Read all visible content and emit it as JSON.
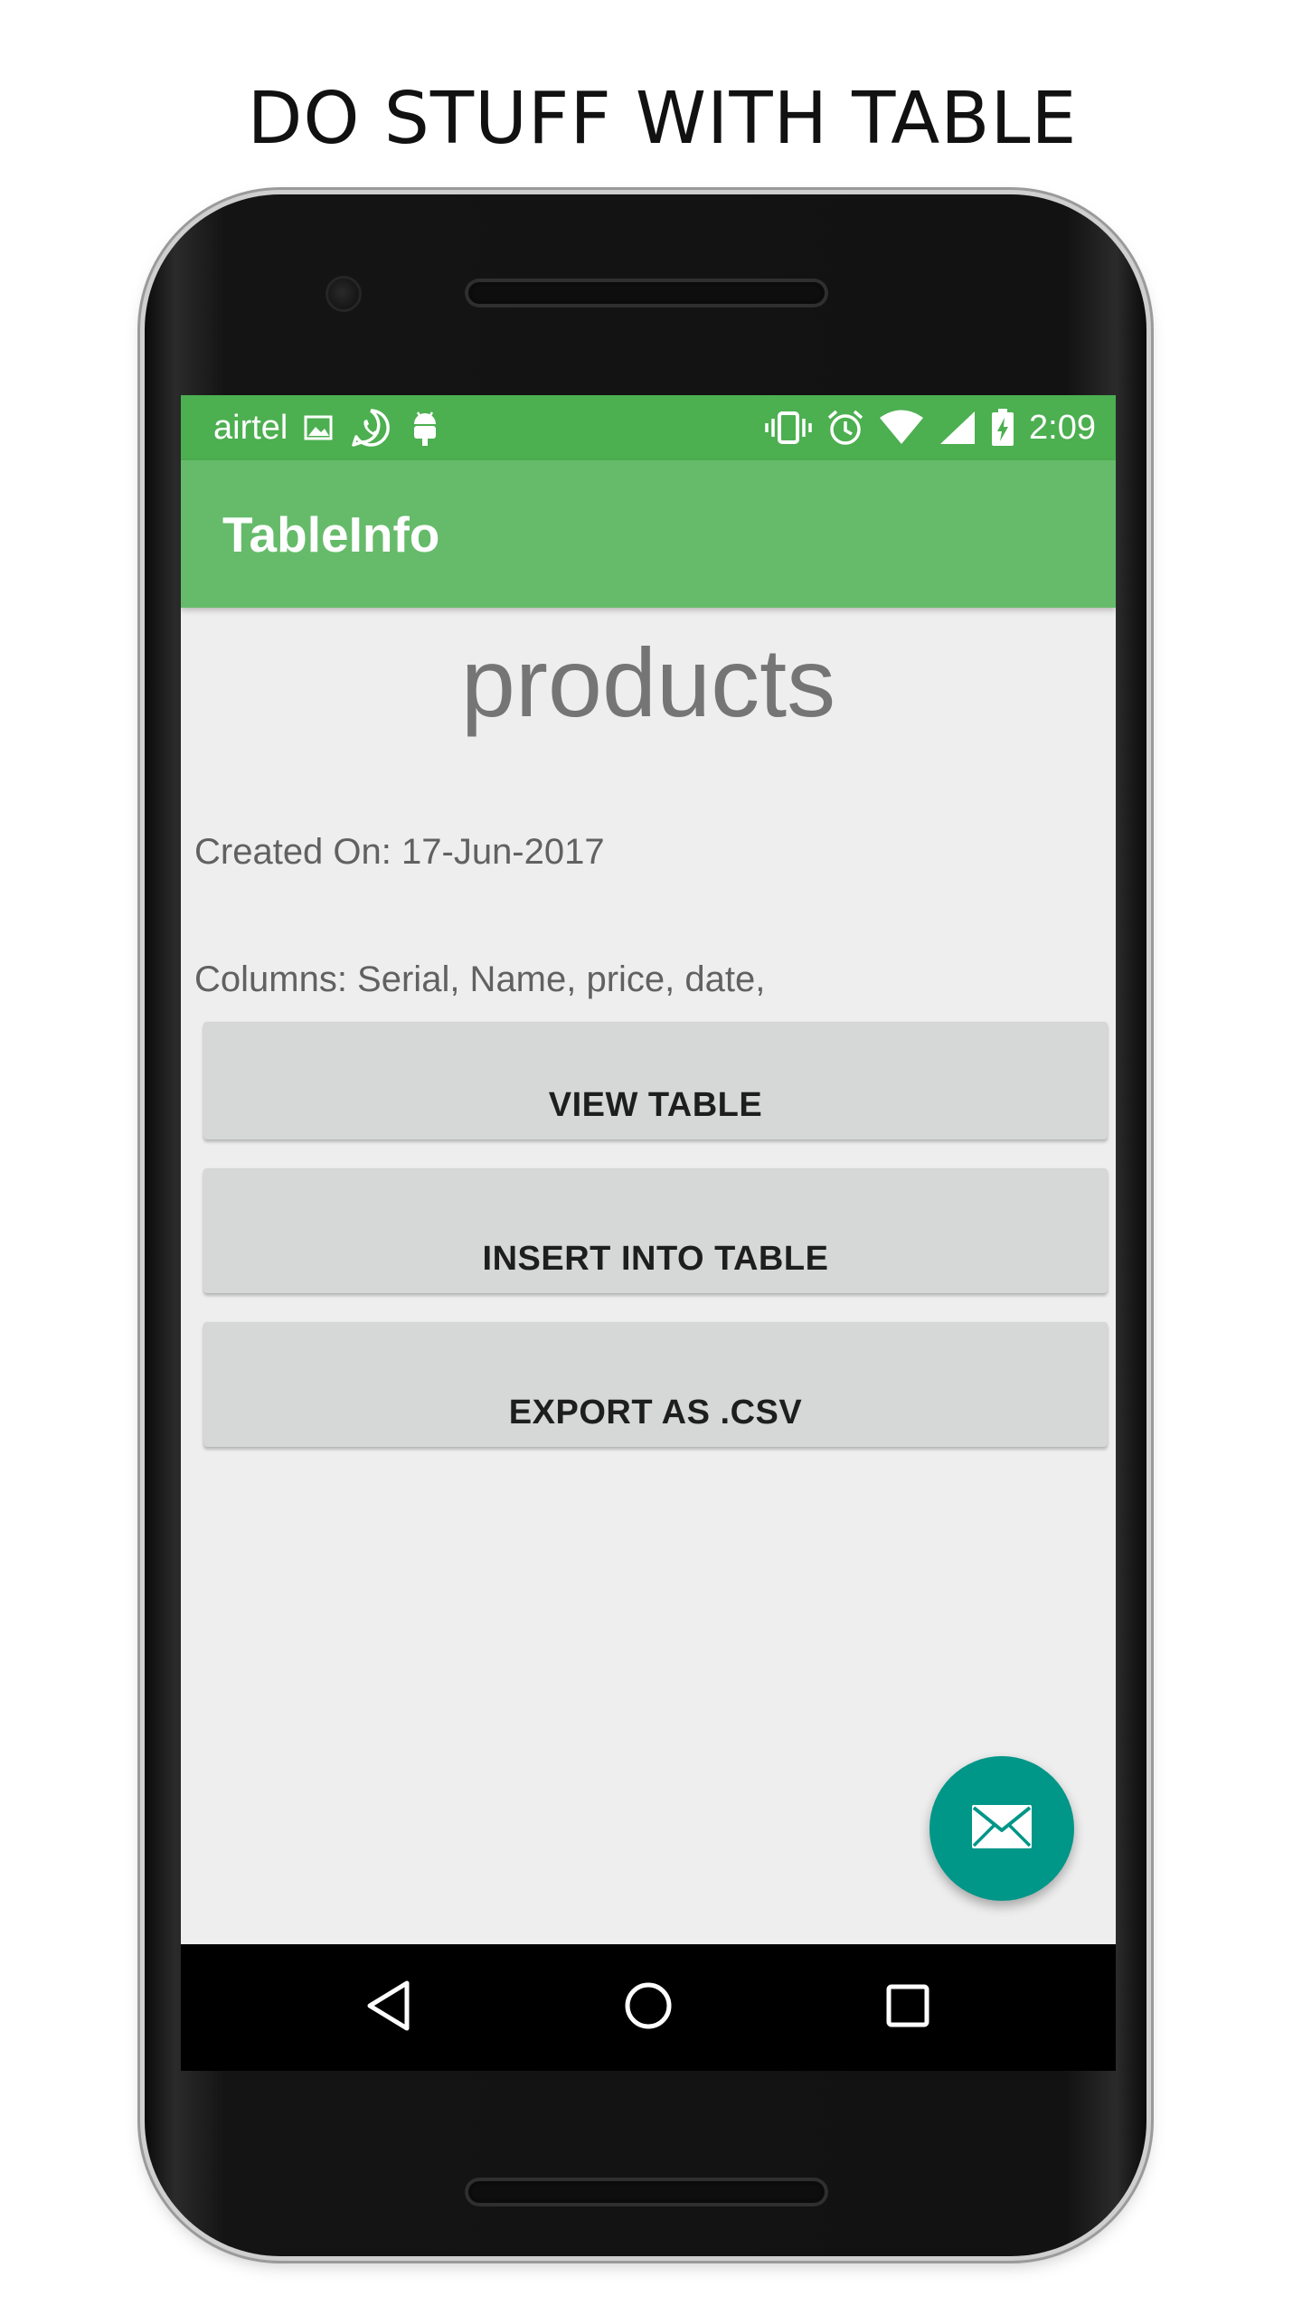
{
  "headline": "DO STUFF WITH TABLE",
  "status_bar": {
    "carrier": "airtel",
    "time": "2:09",
    "left_icons": [
      "image-icon",
      "whatsapp-icon",
      "android-icon"
    ],
    "right_icons": [
      "vibrate-icon",
      "alarm-icon",
      "wifi-icon",
      "signal-icon",
      "battery-charging-icon"
    ]
  },
  "app_bar": {
    "title": "TableInfo"
  },
  "table": {
    "name": "products",
    "created_on": "Created On: 17-Jun-2017",
    "columns": "Columns: Serial, Name, price, date,"
  },
  "buttons": {
    "view": "VIEW TABLE",
    "insert": "INSERT INTO TABLE",
    "export": "EXPORT AS .CSV"
  },
  "fab": {
    "icon": "mail-icon"
  },
  "nav_bar": {
    "icons": [
      "back-icon",
      "home-icon",
      "recents-icon"
    ]
  },
  "colors": {
    "status_bar": "#4caf50",
    "app_bar": "#66bb6a",
    "fab": "#009688",
    "screen_bg": "#eeeeee",
    "button_bg": "#d6d7d7"
  }
}
